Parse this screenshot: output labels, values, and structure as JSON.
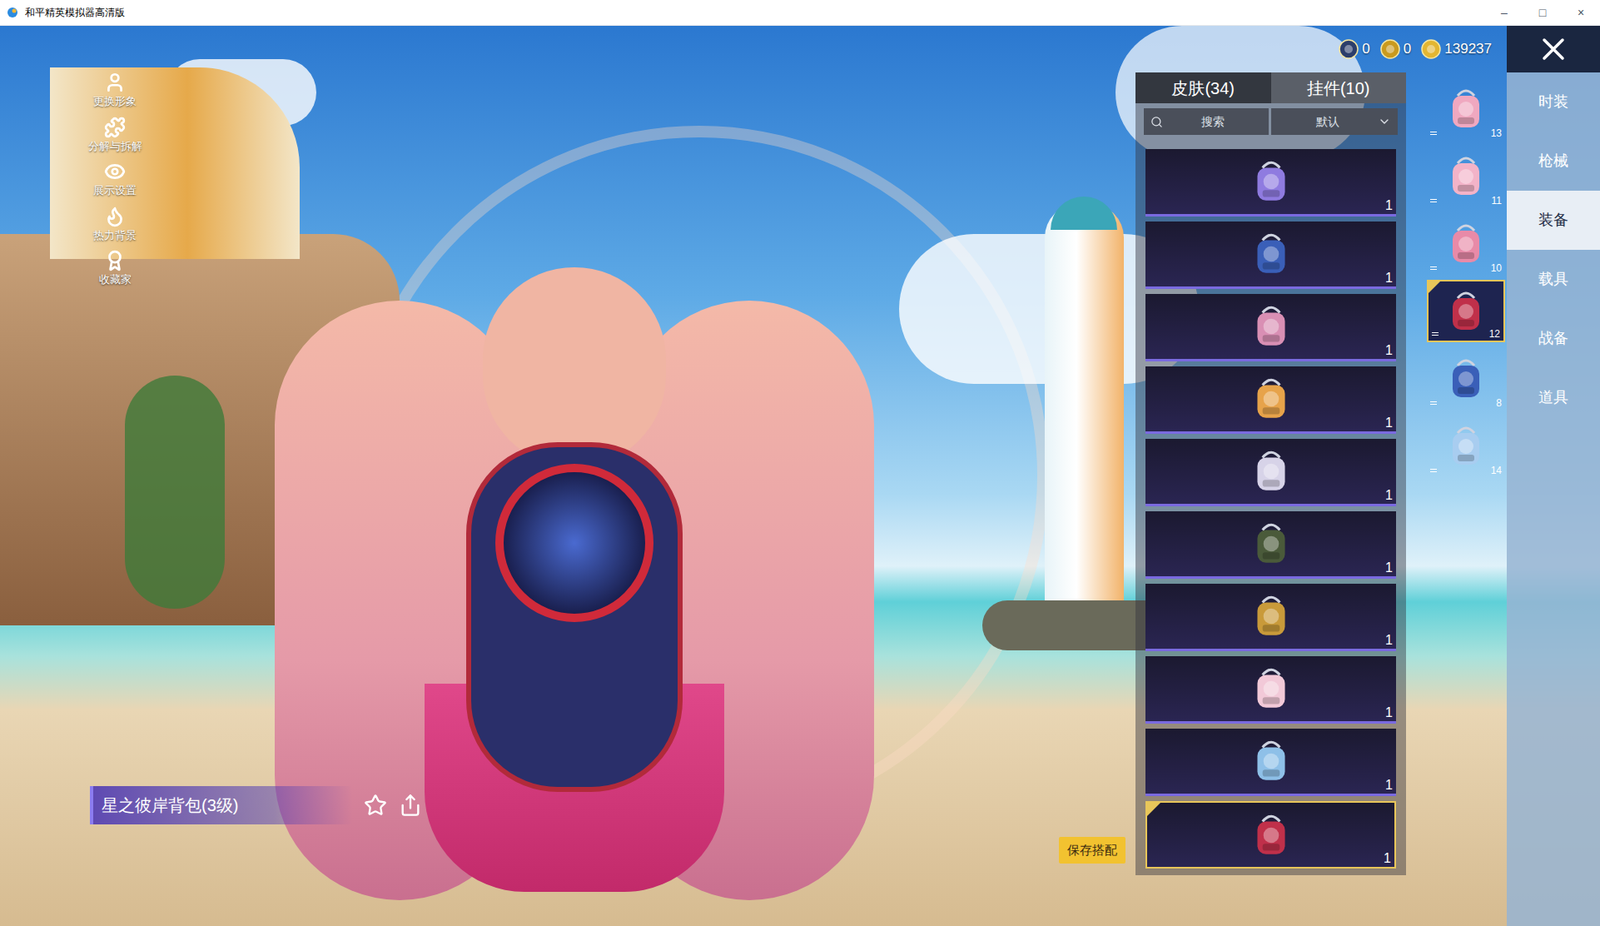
{
  "window": {
    "title": "和平精英模拟器高清版",
    "controls": [
      "–",
      "□",
      "×"
    ]
  },
  "left_menu": [
    {
      "label": "更换形象"
    },
    {
      "label": "分解与拆解"
    },
    {
      "label": "展示设置"
    },
    {
      "label": "热力背景"
    },
    {
      "label": "收藏家"
    }
  ],
  "item_name": "星之彼岸背包(3级)",
  "currencies": [
    {
      "value": "0",
      "color": "#2c3e6b"
    },
    {
      "value": "0",
      "color": "#c99a1e"
    },
    {
      "value": "139237",
      "color": "#e3b632"
    }
  ],
  "save_button": "保存搭配",
  "tabs": [
    {
      "label": "皮肤(34)",
      "selected": true
    },
    {
      "label": "挂件(10)",
      "selected": false
    }
  ],
  "search": {
    "placeholder": "搜索"
  },
  "sort": {
    "value": "默认"
  },
  "items": [
    {
      "count": "1",
      "selected": false
    },
    {
      "count": "1",
      "selected": false
    },
    {
      "count": "1",
      "selected": false
    },
    {
      "count": "1",
      "selected": false
    },
    {
      "count": "1",
      "selected": false
    },
    {
      "count": "1",
      "selected": false
    },
    {
      "count": "1",
      "selected": false
    },
    {
      "count": "1",
      "selected": false
    },
    {
      "count": "1",
      "selected": false
    },
    {
      "count": "1",
      "selected": true
    }
  ],
  "slots": [
    {
      "level": "13",
      "selected": false
    },
    {
      "level": "11",
      "selected": false
    },
    {
      "level": "10",
      "selected": false
    },
    {
      "level": "12",
      "selected": true
    },
    {
      "level": "8",
      "selected": false
    },
    {
      "level": "14",
      "selected": false
    }
  ],
  "nav": [
    {
      "label": "时装",
      "selected": false
    },
    {
      "label": "枪械",
      "selected": false
    },
    {
      "label": "装备",
      "selected": true
    },
    {
      "label": "载具",
      "selected": false
    },
    {
      "label": "战备",
      "selected": false
    },
    {
      "label": "道具",
      "selected": false
    }
  ]
}
